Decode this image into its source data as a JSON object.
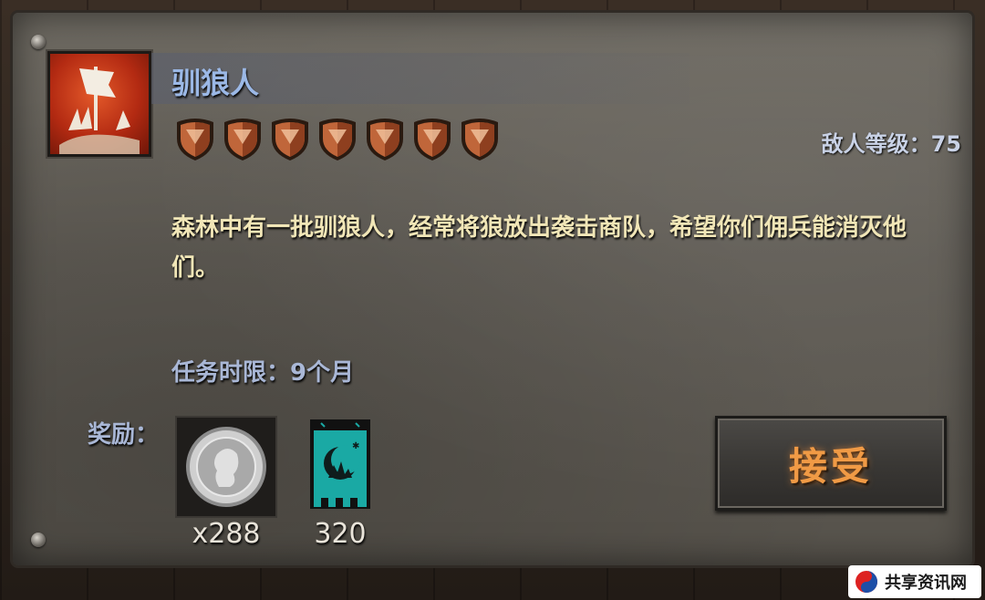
{
  "quest": {
    "title": "驯狼人",
    "stars": 7,
    "enemy_level_label": "敌人等级：75",
    "description": "森林中有一批驯狼人，经常将狼放出袭击商队，希望你们佣兵能消灭他们。",
    "deadline": "任务时限：9个月"
  },
  "rewards": {
    "label": "奖励：",
    "coin_count": "x288",
    "banner_count": "320"
  },
  "buttons": {
    "accept": "接受"
  },
  "watermark": {
    "text": "共享资讯网"
  },
  "colors": {
    "title": "#9bb8e6",
    "description": "#f1e6b7",
    "accept": "#f09a45",
    "banner": "#1aa9a4"
  }
}
